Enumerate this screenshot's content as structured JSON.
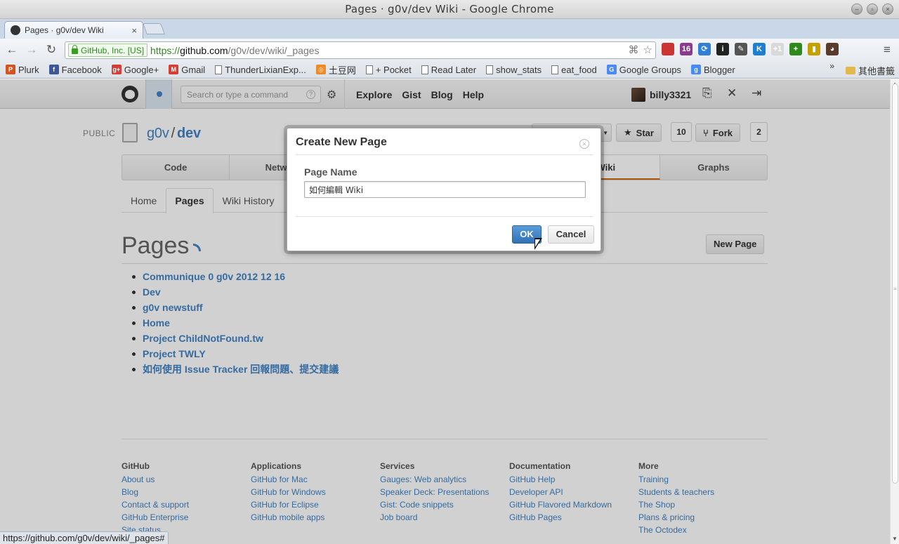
{
  "window": {
    "title": "Pages ·  g0v/dev Wiki - Google Chrome",
    "buttons": [
      "minimize",
      "maximize",
      "close"
    ]
  },
  "tab": {
    "title": "Pages ·  g0v/dev Wiki",
    "close": "×"
  },
  "toolbar": {
    "back": "←",
    "forward": "→",
    "reload": "↻",
    "ev_cert": "GitHub, Inc. [US]",
    "url_scheme": "https://",
    "url_host": "github.com",
    "url_path": "/g0v/dev/wiki/_pages",
    "menu": "≡",
    "star": "☆"
  },
  "extensions": [
    {
      "name": "pocket-icon",
      "label": "",
      "color": "#cc3333"
    },
    {
      "name": "gmail-checker-icon",
      "label": "16",
      "color": "#8a3b8f"
    },
    {
      "name": "sync-icon",
      "label": "⟳",
      "color": "#2f7fd4"
    },
    {
      "name": "info-icon",
      "label": "i",
      "color": "#222222"
    },
    {
      "name": "tools-icon",
      "label": "✎",
      "color": "#555555"
    },
    {
      "name": "klout-icon",
      "label": "K",
      "color": "#1e7fd1"
    },
    {
      "name": "google-plus-one-icon",
      "label": "+1",
      "color": "#d9d9d9"
    },
    {
      "name": "plus-icon",
      "label": "+",
      "color": "#2f8a1e"
    },
    {
      "name": "usb-icon",
      "label": "▮",
      "color": "#c4a000"
    },
    {
      "name": "avatar-ext-icon",
      "label": "◕",
      "color": "#5a3a2a"
    }
  ],
  "bookmarks": [
    {
      "label": "Plurk",
      "icon": "P",
      "color": "#d3541f"
    },
    {
      "label": "Facebook",
      "icon": "f",
      "color": "#3b5998"
    },
    {
      "label": "Google+",
      "icon": "g+",
      "color": "#d73d32"
    },
    {
      "label": "Gmail",
      "icon": "M",
      "color": "#d73d32"
    },
    {
      "label": "ThunderLixianExp...",
      "icon": "page"
    },
    {
      "label": "土豆网",
      "icon": "◎",
      "color": "#f08a24"
    },
    {
      "label": "+ Pocket",
      "icon": "page"
    },
    {
      "label": "Read Later",
      "icon": "page"
    },
    {
      "label": "show_stats",
      "icon": "page"
    },
    {
      "label": "eat_food",
      "icon": "page"
    },
    {
      "label": "Google Groups",
      "icon": "G",
      "color": "#4a8af4"
    },
    {
      "label": "Blogger",
      "icon": "g",
      "color": "#4a8af4"
    }
  ],
  "bookmarks_more": "»",
  "bookmarks_other": "其他書籤",
  "github": {
    "search_placeholder": "Search or type a command",
    "search_help": "?",
    "nav": [
      "Explore",
      "Gist",
      "Blog",
      "Help"
    ],
    "username": "billy3321"
  },
  "repo": {
    "visibility": "PUBLIC",
    "owner": "g0v",
    "separator": "/",
    "name": "dev",
    "watch_label": "",
    "star_label": "Star",
    "star_count": "10",
    "fork_label": "Fork",
    "fork_count": "2",
    "tabs": [
      {
        "label": "Code",
        "selected": false
      },
      {
        "label": "Network",
        "selected": false
      },
      {
        "label": "",
        "selected": false
      },
      {
        "label": "",
        "selected": false
      },
      {
        "label": "Wiki",
        "selected": true
      },
      {
        "label": "Graphs",
        "selected": false
      }
    ]
  },
  "wiki": {
    "subnav": [
      {
        "label": "Home",
        "selected": false
      },
      {
        "label": "Pages",
        "selected": true
      },
      {
        "label": "Wiki History",
        "selected": false
      }
    ],
    "heading": "Pages",
    "new_page_button": "New Page",
    "pages": [
      "Communique 0 g0v 2012 12 16",
      "Dev",
      "g0v newstuff",
      "Home",
      "Project ChildNotFound.tw",
      "Project TWLY",
      "如何使用 Issue Tracker 回報問題、提交建議"
    ]
  },
  "footer": [
    {
      "heading": "GitHub",
      "links": [
        "About us",
        "Blog",
        "Contact & support",
        "GitHub Enterprise",
        "Site status"
      ]
    },
    {
      "heading": "Applications",
      "links": [
        "GitHub for Mac",
        "GitHub for Windows",
        "GitHub for Eclipse",
        "GitHub mobile apps"
      ]
    },
    {
      "heading": "Services",
      "links": [
        "Gauges: Web analytics",
        "Speaker Deck: Presentations",
        "Gist: Code snippets",
        "Job board"
      ]
    },
    {
      "heading": "Documentation",
      "links": [
        "GitHub Help",
        "Developer API",
        "GitHub Flavored Markdown",
        "GitHub Pages"
      ]
    },
    {
      "heading": "More",
      "links": [
        "Training",
        "Students & teachers",
        "The Shop",
        "Plans & pricing",
        "The Octodex"
      ]
    }
  ],
  "modal": {
    "title": "Create New Page",
    "close": "×",
    "field_label": "Page Name",
    "field_value": "如何編輯 Wiki",
    "ok": "OK",
    "cancel": "Cancel"
  },
  "status_bar": "https://github.com/g0v/dev/wiki/_pages#"
}
